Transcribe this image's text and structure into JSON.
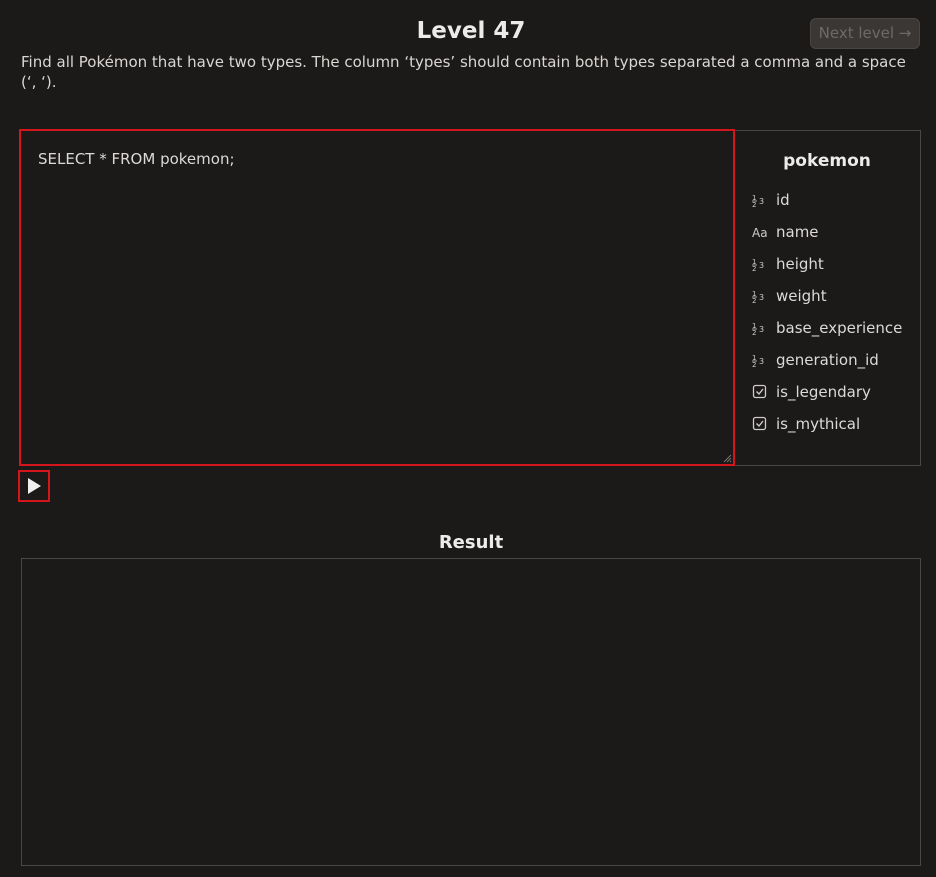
{
  "level": {
    "title": "Level 47",
    "next_label": "Next level →",
    "instructions": "Find all Pokémon that have two types. The column ‘types’ should contain both types separated a comma and a space (‘, ‘)."
  },
  "editor": {
    "query": "SELECT * FROM pokemon;"
  },
  "schema": {
    "table_name": "pokemon",
    "columns": [
      {
        "name": "id",
        "type_icon": "numeric-icon"
      },
      {
        "name": "name",
        "type_icon": "text-icon"
      },
      {
        "name": "height",
        "type_icon": "numeric-icon"
      },
      {
        "name": "weight",
        "type_icon": "numeric-icon"
      },
      {
        "name": "base_experience",
        "type_icon": "numeric-icon"
      },
      {
        "name": "generation_id",
        "type_icon": "numeric-icon"
      },
      {
        "name": "is_legendary",
        "type_icon": "checkbox-icon"
      },
      {
        "name": "is_mythical",
        "type_icon": "checkbox-icon"
      }
    ]
  },
  "run": {
    "icon": "play-icon"
  },
  "result": {
    "title": "Result"
  },
  "colors": {
    "background": "#1c1a19",
    "accent_border": "#d4161c",
    "panel_border": "#4a4644"
  }
}
